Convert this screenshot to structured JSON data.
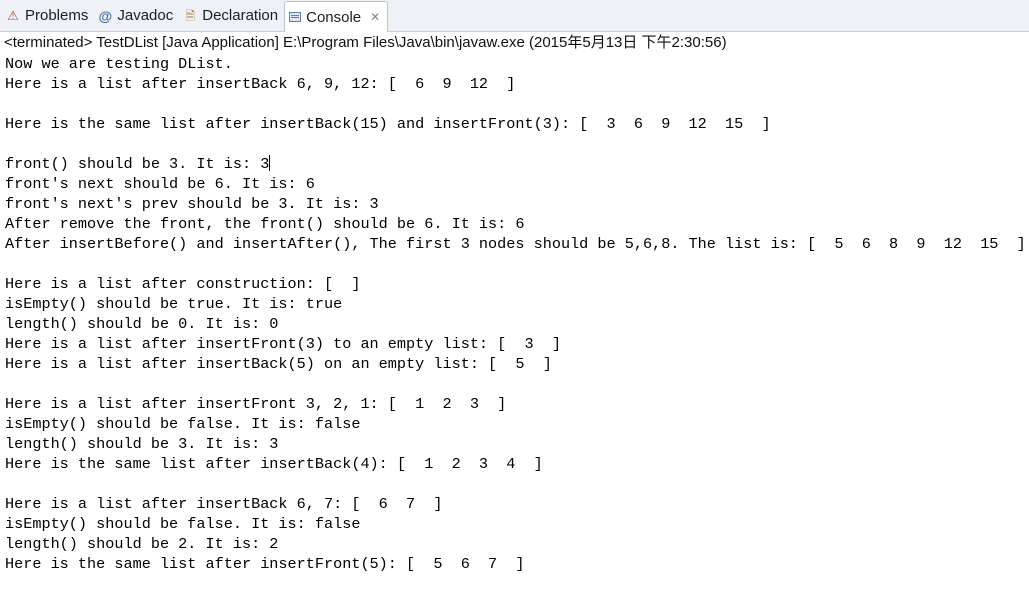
{
  "tabs": [
    {
      "label": "Problems",
      "icon": "problems-icon",
      "active": false
    },
    {
      "label": "Javadoc",
      "icon": "javadoc-icon",
      "active": false
    },
    {
      "label": "Declaration",
      "icon": "declaration-icon",
      "active": false
    },
    {
      "label": "Console",
      "icon": "console-icon",
      "active": true
    }
  ],
  "status": "<terminated> TestDList [Java Application] E:\\Program Files\\Java\\bin\\javaw.exe (2015年5月13日 下午2:30:56)",
  "console_lines": [
    "Now we are testing DList.",
    "Here is a list after insertBack 6, 9, 12: [  6  9  12  ]",
    "",
    "Here is the same list after insertBack(15) and insertFront(3): [  3  6  9  12  15  ]",
    "",
    "front() should be 3. It is: 3",
    "front's next should be 6. It is: 6",
    "front's next's prev should be 3. It is: 3",
    "After remove the front, the front() should be 6. It is: 6",
    "After insertBefore() and insertAfter(), The first 3 nodes should be 5,6,8. The list is: [  5  6  8  9  12  15  ]",
    "",
    "Here is a list after construction: [  ]",
    "isEmpty() should be true. It is: true",
    "length() should be 0. It is: 0",
    "Here is a list after insertFront(3) to an empty list: [  3  ]",
    "Here is a list after insertBack(5) on an empty list: [  5  ]",
    "",
    "Here is a list after insertFront 3, 2, 1: [  1  2  3  ]",
    "isEmpty() should be false. It is: false",
    "length() should be 3. It is: 3",
    "Here is the same list after insertBack(4): [  1  2  3  4  ]",
    "",
    "Here is a list after insertBack 6, 7: [  6  7  ]",
    "isEmpty() should be false. It is: false",
    "length() should be 2. It is: 2",
    "Here is the same list after insertFront(5): [  5  6  7  ]"
  ]
}
